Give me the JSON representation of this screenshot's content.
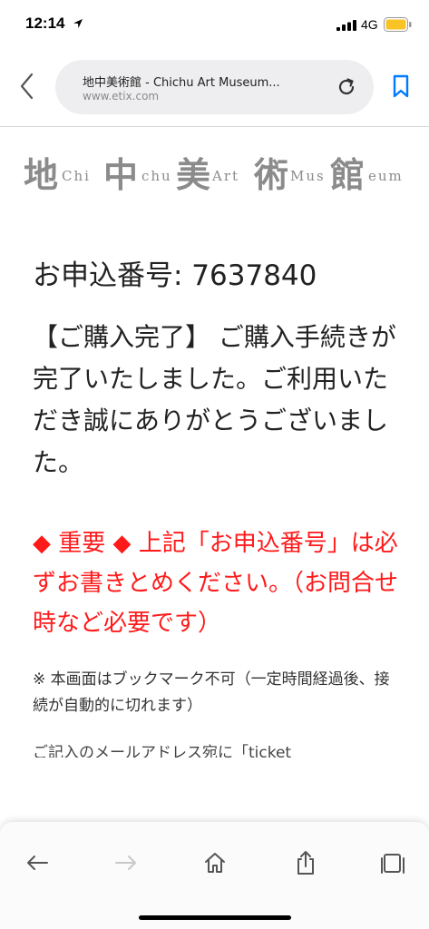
{
  "status": {
    "time": "12:14",
    "network": "4G"
  },
  "browser": {
    "page_title": "地中美術館 - Chichu Art Museum...",
    "url": "www.etix.com",
    "icons": {
      "back": "chevron-left-icon",
      "reload": "reload-icon",
      "bookmark": "bookmark-icon"
    }
  },
  "logo": {
    "k1": "地",
    "l1": "Chi",
    "k2": "中",
    "l2": "chu",
    "k3": "美",
    "l3": "Art",
    "k4": "術",
    "l4": "Mus",
    "k5": "館",
    "l5": "eum"
  },
  "content": {
    "order_number": "お申込番号: 7637840",
    "completion_message": "【ご購入完了】 ご購入手続きが完了いたしました。ご利用いただき誠にありがとうございました。",
    "important_notice": "◆ 重要 ◆ 上記「お申込番号」は必ずお書きとめください。（お問合せ時など必要です）",
    "bookmark_note": "※ 本画面はブックマーク不可（一定時間経過後、接続が自動的に切れます）",
    "partial_line": "ご記入のメールアドレス宛に「ticket"
  },
  "toolbar": {
    "icons": [
      "back-arrow-icon",
      "forward-arrow-icon",
      "home-icon",
      "share-icon",
      "tabs-icon"
    ]
  },
  "colors": {
    "important_red": "#ff1a1a",
    "accent_blue": "#007aff",
    "logo_gray": "#8b8b8b",
    "battery_yellow": "#f7c325"
  }
}
